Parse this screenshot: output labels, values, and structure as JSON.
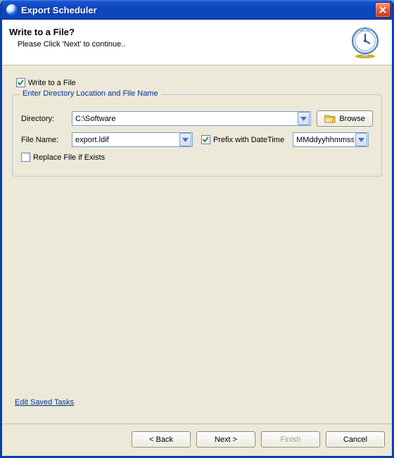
{
  "window_title": "Export Scheduler",
  "header": {
    "title": "Write to a File?",
    "subtitle": "Please Click 'Next' to continue.."
  },
  "write_to_file": {
    "checked": true,
    "label": "Write to a File"
  },
  "group_title": "Enter Directory Location and File Name",
  "directory": {
    "label": "Directory:",
    "value": "C:\\Software",
    "browse_label": "Browse"
  },
  "filename": {
    "label": "File Name:",
    "value": "export.ldif"
  },
  "prefix": {
    "checked": true,
    "label": "Prefix with DateTime",
    "format": "MMddyyhhmmss"
  },
  "replace": {
    "checked": false,
    "label": "Replace File if Exists"
  },
  "link_saved_tasks": "Edit Saved Tasks",
  "buttons": {
    "back": "< Back",
    "next": "Next >",
    "finish": "Finish",
    "cancel": "Cancel"
  }
}
